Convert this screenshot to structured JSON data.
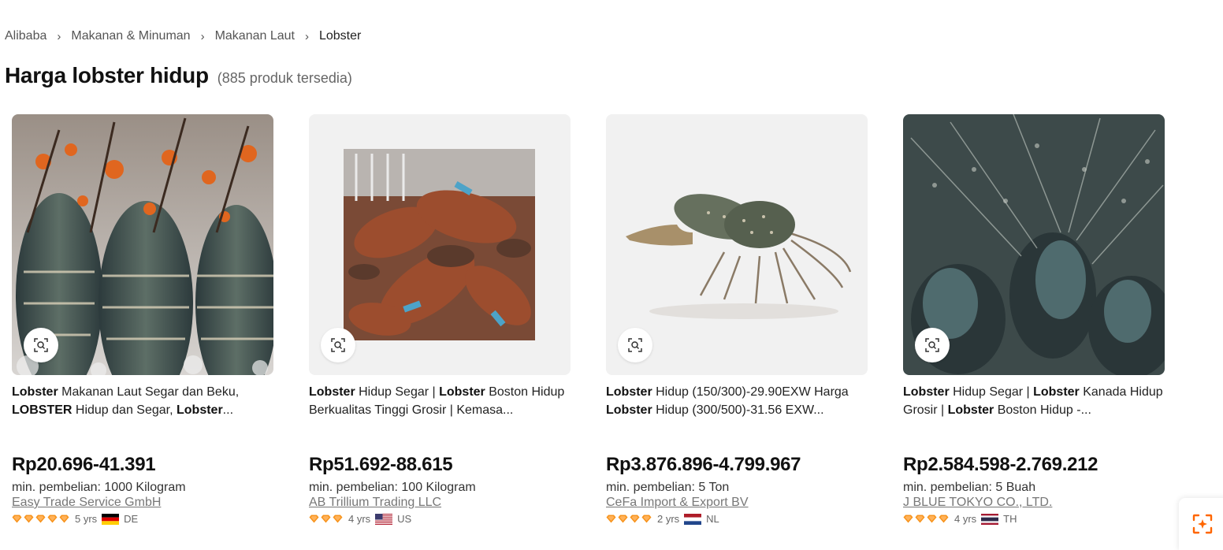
{
  "breadcrumb": [
    {
      "label": "Alibaba"
    },
    {
      "label": "Makanan & Minuman"
    },
    {
      "label": "Makanan Laut"
    },
    {
      "label": "Lobster"
    }
  ],
  "page": {
    "title": "Harga lobster hidup",
    "count": "(885 produk tersedia)"
  },
  "colors": {
    "accent": "#FF6600",
    "diamond": "#F7941D"
  },
  "icons": {
    "image_search": "image-search-icon",
    "diamond": "supplier-diamond-icon"
  },
  "products": [
    {
      "title_parts": [
        {
          "text": "Lobster",
          "bold": true
        },
        {
          "text": " Makanan Laut Segar dan Beku, ",
          "bold": false
        },
        {
          "text": "LOBSTER",
          "bold": true
        },
        {
          "text": " Hidup dan Segar, ",
          "bold": false
        },
        {
          "text": "Lobster",
          "bold": true
        },
        {
          "text": "...",
          "bold": false
        }
      ],
      "price": "Rp20.696-41.391",
      "moq": "min. pembelian: 1000 Kilogram",
      "supplier": "Easy Trade Service GmbH",
      "diamonds": 5,
      "years": "5 yrs",
      "country": "DE",
      "flag": "de"
    },
    {
      "title_parts": [
        {
          "text": "Lobster",
          "bold": true
        },
        {
          "text": " Hidup Segar | ",
          "bold": false
        },
        {
          "text": "Lobster",
          "bold": true
        },
        {
          "text": " Boston Hidup Berkualitas Tinggi Grosir | Kemasa...",
          "bold": false
        }
      ],
      "price": "Rp51.692-88.615",
      "moq": "min. pembelian: 100 Kilogram",
      "supplier": "AB Trillium Trading LLC",
      "diamonds": 3,
      "years": "4 yrs",
      "country": "US",
      "flag": "us"
    },
    {
      "title_parts": [
        {
          "text": "Lobster",
          "bold": true
        },
        {
          "text": " Hidup (150/300)-29.90EXW Harga ",
          "bold": false
        },
        {
          "text": "Lobster",
          "bold": true
        },
        {
          "text": " Hidup (300/500)-31.56 EXW...",
          "bold": false
        }
      ],
      "price": "Rp3.876.896-4.799.967",
      "moq": "min. pembelian: 5 Ton",
      "supplier": "CeFa Import & Export BV",
      "diamonds": 4,
      "years": "2 yrs",
      "country": "NL",
      "flag": "nl"
    },
    {
      "title_parts": [
        {
          "text": "Lobster",
          "bold": true
        },
        {
          "text": " Hidup Segar | ",
          "bold": false
        },
        {
          "text": "Lobster",
          "bold": true
        },
        {
          "text": " Kanada Hidup Grosir | ",
          "bold": false
        },
        {
          "text": "Lobster",
          "bold": true
        },
        {
          "text": " Boston Hidup -...",
          "bold": false
        }
      ],
      "price": "Rp2.584.598-2.769.212",
      "moq": "min. pembelian: 5 Buah",
      "supplier": "J BLUE TOKYO CO., LTD.",
      "diamonds": 4,
      "years": "4 yrs",
      "country": "TH",
      "flag": "th"
    }
  ]
}
